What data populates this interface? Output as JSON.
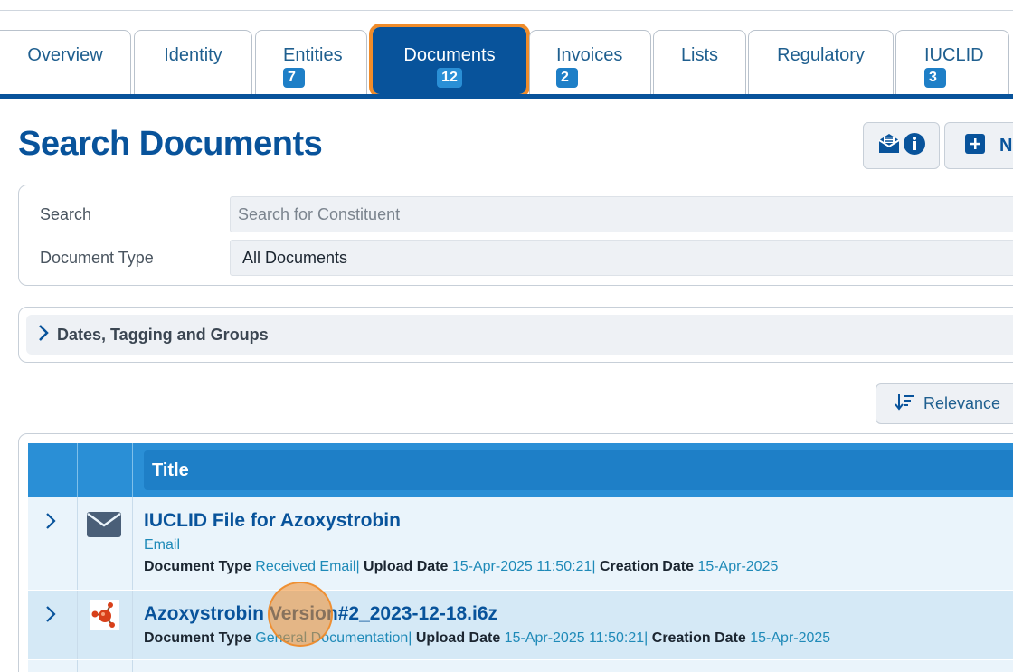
{
  "tabs": [
    {
      "label": "Overview",
      "badge": ""
    },
    {
      "label": "Identity",
      "badge": ""
    },
    {
      "label": "Entities",
      "badge": "7"
    },
    {
      "label": "Documents",
      "badge": "12"
    },
    {
      "label": "Invoices",
      "badge": "2"
    },
    {
      "label": "Lists",
      "badge": ""
    },
    {
      "label": "Regulatory",
      "badge": ""
    },
    {
      "label": "IUCLID",
      "badge": "3"
    }
  ],
  "active_tab": "Documents",
  "page_title": "Search Documents",
  "toolbar": {
    "new_label": "N",
    "info_icon": "envelope-info-icon",
    "new_icon": "plus-icon"
  },
  "search": {
    "search_label": "Search",
    "search_placeholder": "Search for Constituent",
    "search_value": "",
    "type_label": "Document Type",
    "type_value": "All Documents"
  },
  "filters": {
    "dates_label": "Dates, Tagging and Groups"
  },
  "sort": {
    "label": "Relevance",
    "icon": "sort-descending-icon"
  },
  "table": {
    "title_header": "Title",
    "rows": [
      {
        "title": "IUCLID File for Azoxystrobin",
        "subtitle": "Email",
        "icon": "envelope-icon",
        "doc_type_label": "Document Type",
        "doc_type": "Received Email",
        "upload_label": "Upload Date",
        "upload_date": "15-Apr-2025 11:50:21",
        "creation_label": "Creation Date",
        "creation_date": "15-Apr-2025"
      },
      {
        "title": "Azoxystrobin Version#2_2023-12-18.i6z",
        "subtitle": "",
        "icon": "molecule-icon",
        "doc_type_label": "Document Type",
        "doc_type": "General Documentation",
        "upload_label": "Upload Date",
        "upload_date": "15-Apr-2025 11:50:21",
        "creation_label": "Creation Date",
        "creation_date": "15-Apr-2025"
      }
    ]
  },
  "colors": {
    "primary": "#08539b",
    "header_blue": "#2a8fd6",
    "accent_orange": "#f08c2a",
    "link_teal": "#1f8ab8"
  }
}
